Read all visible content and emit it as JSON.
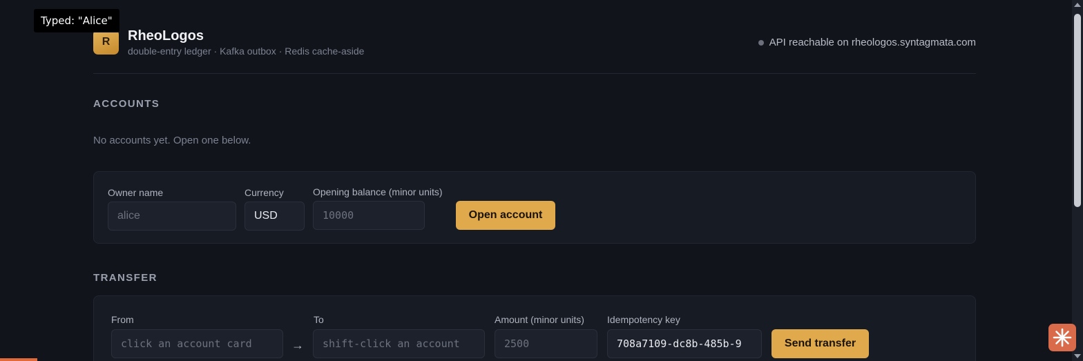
{
  "tooltip": "Typed: \"Alice\"",
  "brand": {
    "logo_letter": "R",
    "title": "RheoLogos",
    "subtitle": "double-entry ledger · Kafka outbox · Redis cache-aside"
  },
  "status": {
    "text": "API reachable on rheologos.syntagmata.com"
  },
  "accounts": {
    "heading": "ACCOUNTS",
    "empty_text": "No accounts yet. Open one below.",
    "form": {
      "owner_label": "Owner name",
      "owner_placeholder": "alice",
      "currency_label": "Currency",
      "currency_value": "USD",
      "balance_label": "Opening balance (minor units)",
      "balance_placeholder": "10000",
      "submit_label": "Open account"
    }
  },
  "transfer": {
    "heading": "TRANSFER",
    "form": {
      "from_label": "From",
      "from_placeholder": "click an account card",
      "arrow": "→",
      "to_label": "To",
      "to_placeholder": "shift-click an account",
      "amount_label": "Amount (minor units)",
      "amount_placeholder": "2500",
      "key_label": "Idempotency key",
      "key_value": "708a7109-dc8b-485b-9",
      "submit_label": "Send transfer"
    }
  },
  "colors": {
    "background": "#11141b",
    "accent": "#e0a94b",
    "panel": "#171b23"
  },
  "icons": {
    "assistant": "sparkle-icon",
    "status": "status-dot-icon"
  }
}
